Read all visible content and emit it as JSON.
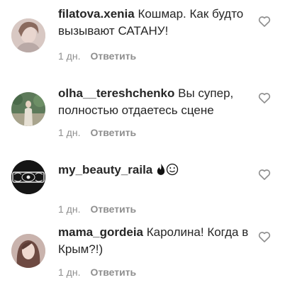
{
  "comments": [
    {
      "username": "filatova.xenia",
      "text": " Кошмар. Как будто вызывают САТАНУ!",
      "time": "1 дн.",
      "reply_label": "Ответить",
      "avatar_icon": "user-avatar-photo"
    },
    {
      "username": "olha__tereshchenko",
      "text": " Вы супер, полностью отдаетесь сцене",
      "time": "1 дн.",
      "reply_label": "Ответить",
      "avatar_icon": "user-avatar-photo"
    },
    {
      "username": "my_beauty_raila",
      "text": "",
      "emojis": [
        "fire-icon",
        "smiling-face-icon"
      ],
      "time": "1 дн.",
      "reply_label": "Ответить",
      "avatar_icon": "logo-avatar"
    },
    {
      "username": "mama_gordeia",
      "text": " Каролина! Когда в Крым?!)",
      "time": "1 дн.",
      "reply_label": "Ответить",
      "avatar_icon": "user-avatar-photo"
    }
  ],
  "colors": {
    "text": "#262626",
    "meta": "#8e8e8e",
    "heart_stroke": "#8e8e8e"
  }
}
